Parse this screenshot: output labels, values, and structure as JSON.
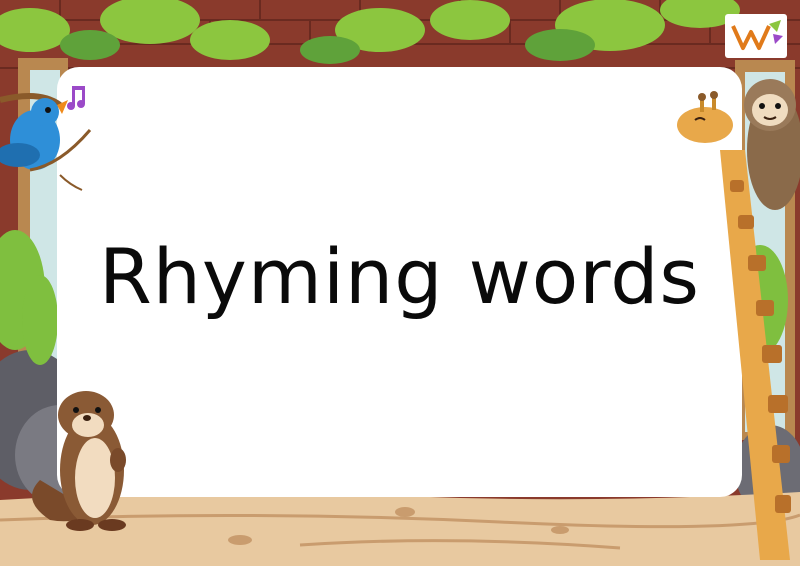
{
  "slide": {
    "title": "Rhyming words"
  },
  "colors": {
    "card": "#ffffff",
    "brick": "#8a3a2c",
    "ground": "#e8c9a0",
    "leaf": "#8cc63f"
  },
  "icons": [
    "music-note-icon",
    "logo-icon"
  ]
}
